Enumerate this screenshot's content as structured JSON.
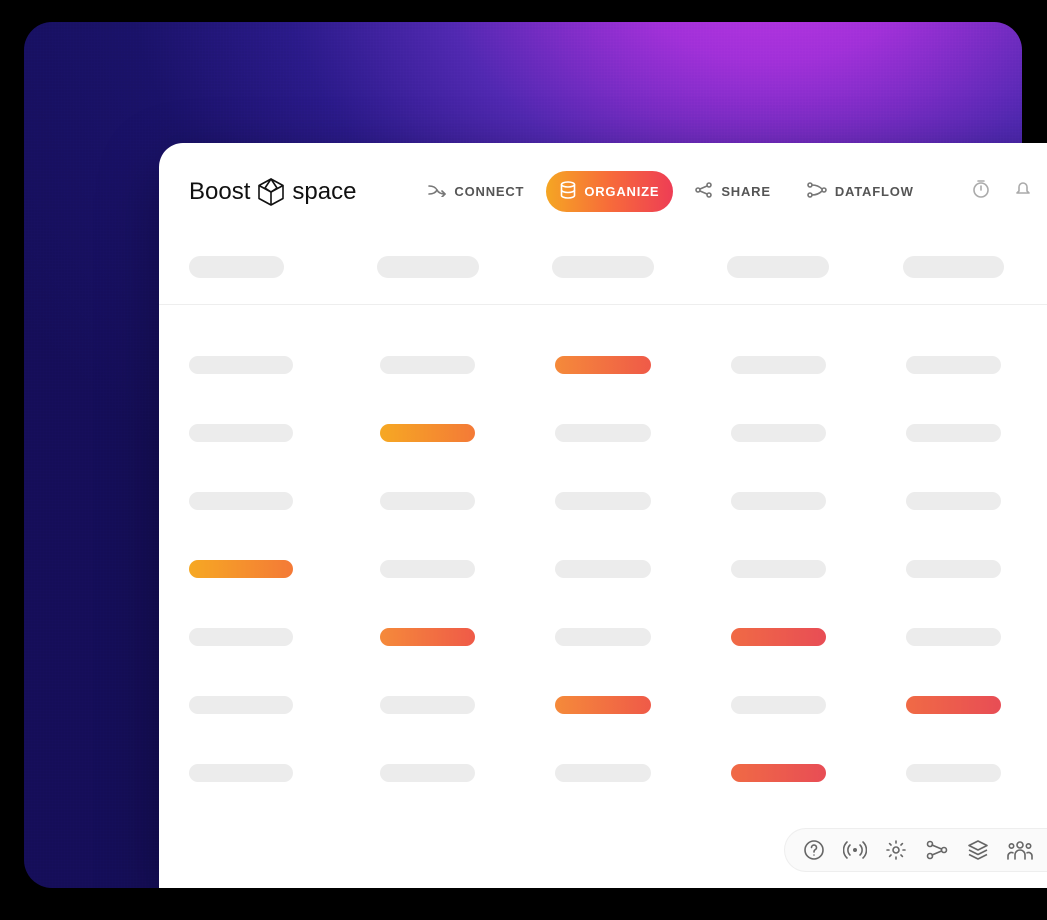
{
  "logo": {
    "part1": "Boost",
    "part2": "space"
  },
  "nav": {
    "items": [
      {
        "label": "CONNECT",
        "active": false
      },
      {
        "label": "ORGANIZE",
        "active": true
      },
      {
        "label": "SHARE",
        "active": false
      },
      {
        "label": "DATAFLOW",
        "active": false
      }
    ]
  },
  "grid": {
    "columns": 5,
    "rows": [
      {
        "highlights": [
          false,
          false,
          "hl2",
          false,
          false
        ]
      },
      {
        "highlights": [
          false,
          "hl",
          false,
          false,
          false
        ]
      },
      {
        "highlights": [
          false,
          false,
          false,
          false,
          false
        ]
      },
      {
        "highlights": [
          "hl",
          false,
          false,
          false,
          false
        ]
      },
      {
        "highlights": [
          false,
          "hl2",
          false,
          "hl3",
          false
        ]
      },
      {
        "highlights": [
          false,
          false,
          "hl2",
          false,
          "hl3"
        ]
      },
      {
        "highlights": [
          false,
          false,
          false,
          "hl3",
          false
        ]
      }
    ]
  },
  "toolbar": {
    "icons": [
      "help",
      "broadcast",
      "settings",
      "network",
      "layers",
      "team"
    ]
  }
}
